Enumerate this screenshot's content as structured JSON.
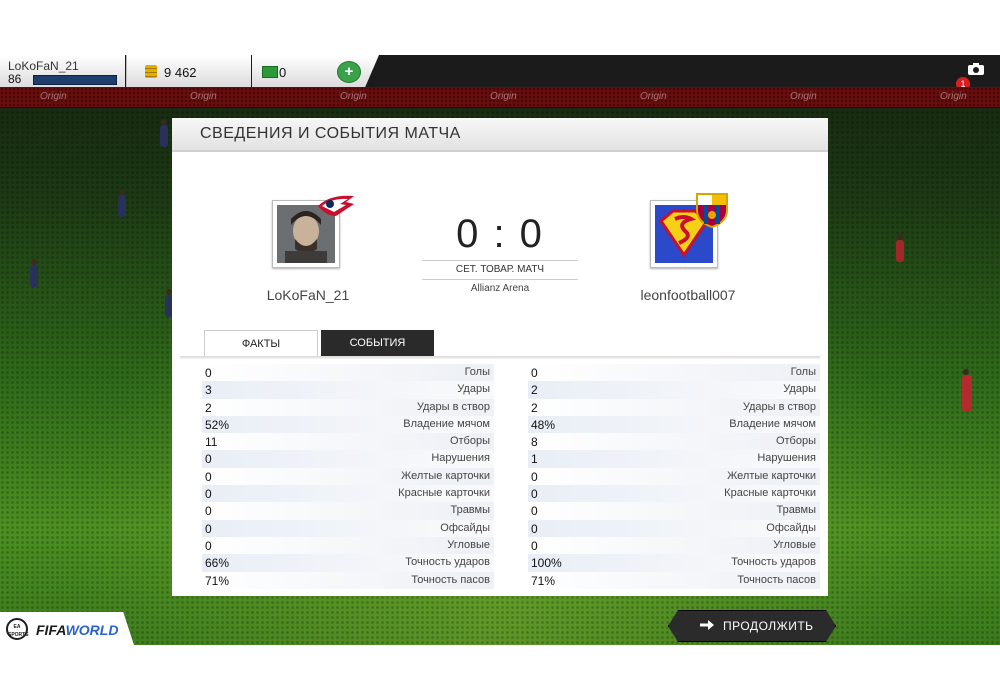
{
  "topbar": {
    "username": "LoKoFaN_21",
    "level": "86",
    "coins": "9 462",
    "cash": "0",
    "add_label": "+",
    "notification_count": "1"
  },
  "adboard": {
    "text": "Origin"
  },
  "panel": {
    "title": "СВЕДЕНИЯ И СОБЫТИЯ МАТЧА",
    "home_name": "LoKoFaN_21",
    "away_name": "leonfootball007",
    "score": "0 : 0",
    "match_type": "СЕТ. ТОВАР. МАТЧ",
    "stadium": "Allianz Arena",
    "tabs": {
      "facts": "ФАКТЫ",
      "events": "СОБЫТИЯ"
    }
  },
  "stats": {
    "home": [
      {
        "value": "0",
        "label": "Голы"
      },
      {
        "value": "3",
        "label": "Удары"
      },
      {
        "value": "2",
        "label": "Удары в створ"
      },
      {
        "value": "52%",
        "label": "Владение мячом"
      },
      {
        "value": "11",
        "label": "Отборы"
      },
      {
        "value": "0",
        "label": "Нарушения"
      },
      {
        "value": "0",
        "label": "Желтые карточки"
      },
      {
        "value": "0",
        "label": "Красные карточки"
      },
      {
        "value": "0",
        "label": "Травмы"
      },
      {
        "value": "0",
        "label": "Офсайды"
      },
      {
        "value": "0",
        "label": "Угловые"
      },
      {
        "value": "66%",
        "label": "Точность ударов"
      },
      {
        "value": "71%",
        "label": "Точность пасов"
      }
    ],
    "away": [
      {
        "value": "0",
        "label": "Голы"
      },
      {
        "value": "2",
        "label": "Удары"
      },
      {
        "value": "2",
        "label": "Удары в створ"
      },
      {
        "value": "48%",
        "label": "Владение мячом"
      },
      {
        "value": "8",
        "label": "Отборы"
      },
      {
        "value": "1",
        "label": "Нарушения"
      },
      {
        "value": "0",
        "label": "Желтые карточки"
      },
      {
        "value": "0",
        "label": "Красные карточки"
      },
      {
        "value": "0",
        "label": "Травмы"
      },
      {
        "value": "0",
        "label": "Офсайды"
      },
      {
        "value": "0",
        "label": "Угловые"
      },
      {
        "value": "100%",
        "label": "Точность ударов"
      },
      {
        "value": "71%",
        "label": "Точность пасов"
      }
    ]
  },
  "footer": {
    "continue_label": "ПРОДОЛЖИТЬ",
    "ea_logo": "EA SPORTS",
    "brand_fifa": "FIFA",
    "brand_world": "WORLD"
  },
  "colors": {
    "topbar": "#1b1b1b",
    "tab_active": "#2a2a2a",
    "xp_bar": "#1e3f6e",
    "add_button": "#3aa24a",
    "notification": "#d81e1e"
  }
}
